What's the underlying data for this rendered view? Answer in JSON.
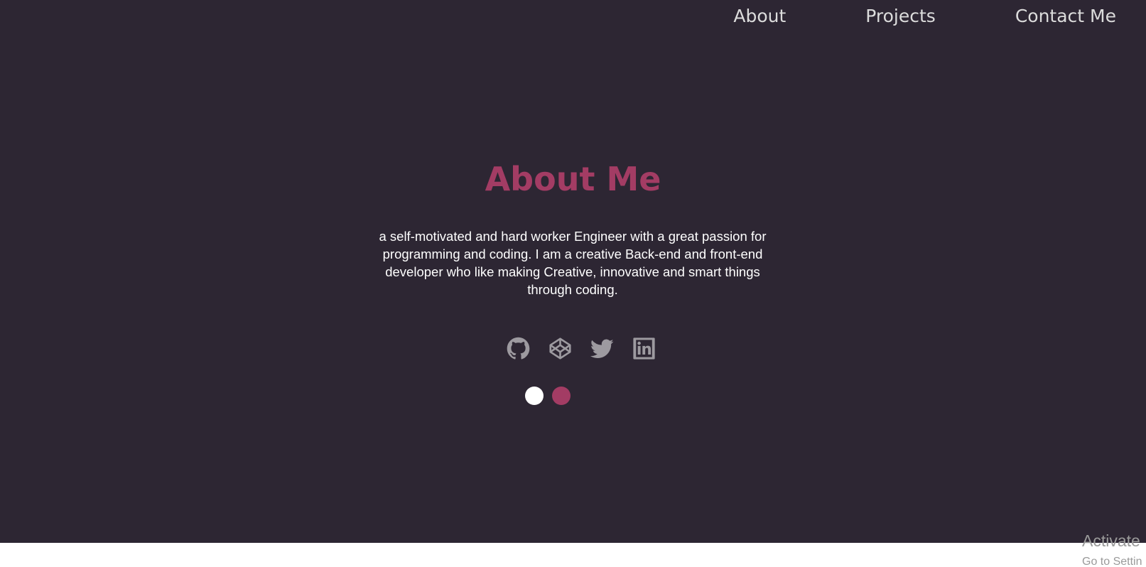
{
  "nav": {
    "about": "About",
    "projects": "Projects",
    "contact": "Contact Me"
  },
  "hero": {
    "title": "About Me",
    "bio": "a self-motivated and hard worker Engineer with a great passion for programming and coding. I am a creative Back-end and front-end developer who like making Creative, innovative and smart things through coding."
  },
  "social": [
    {
      "icon": "github-icon"
    },
    {
      "icon": "codepen-icon"
    },
    {
      "icon": "twitter-icon"
    },
    {
      "icon": "linkedin-icon"
    }
  ],
  "theme_toggles": [
    {
      "color": "#ffffff"
    },
    {
      "color": "#a33c64"
    }
  ],
  "watermark": {
    "line1": "Activate",
    "line2": "Go to Settin"
  },
  "colors": {
    "background": "#2d2633",
    "accent": "#a33c64",
    "icon": "#9d9aa0",
    "nav_text": "#dcdcdc"
  }
}
